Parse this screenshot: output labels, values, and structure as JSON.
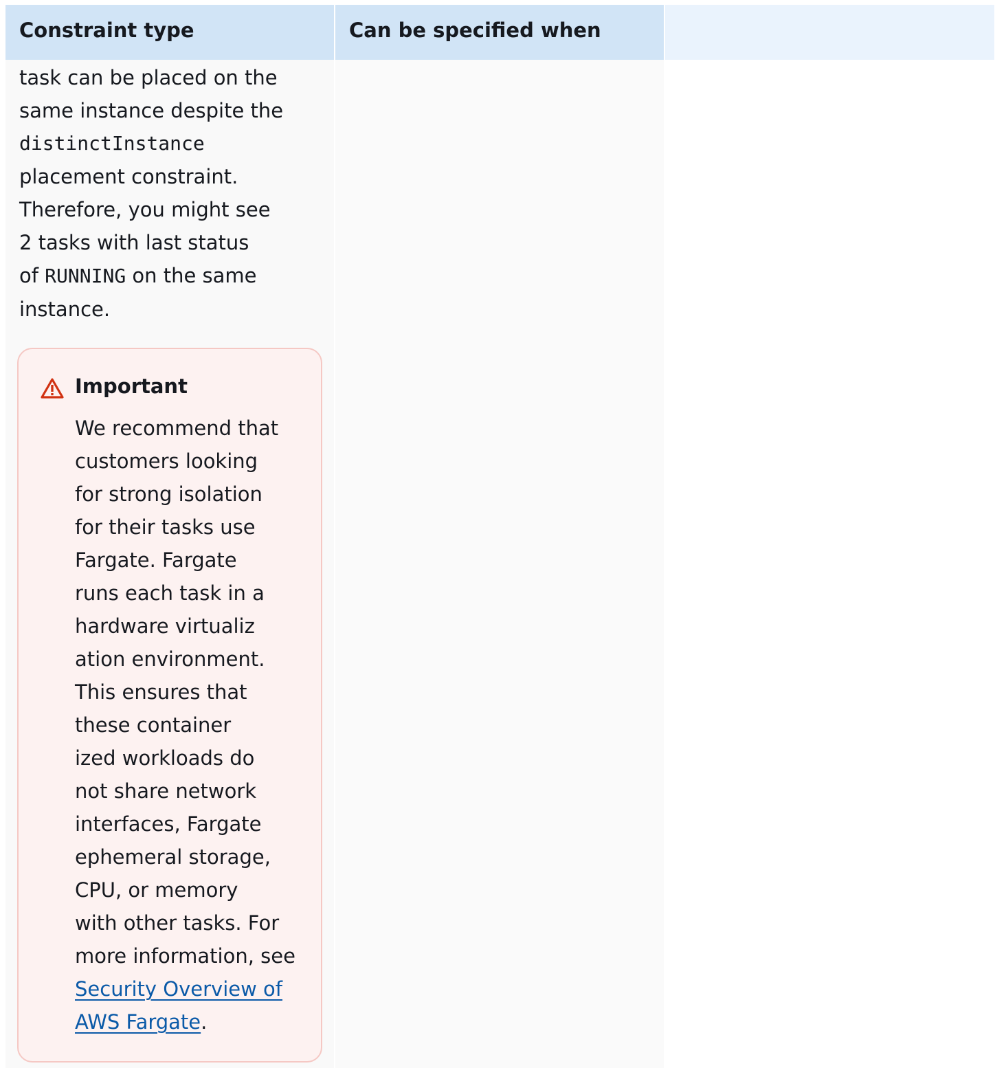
{
  "table": {
    "headers": [
      "Constraint type",
      "Can be specified when",
      ""
    ]
  },
  "row": {
    "text_lines": [
      "task can be placed on the",
      "same instance despite the",
      "distinctInstance",
      "placement constraint.",
      "Therefore, you might see",
      "2 tasks with last status",
      "of RUNNING on the same",
      "instance."
    ],
    "code_terms": [
      "distinctInstance",
      "RUNNING"
    ]
  },
  "alert": {
    "icon": "warning-icon",
    "title": "Important",
    "body_lines": [
      "We recommend that",
      "customers looking",
      "for strong isolation",
      "for their tasks use",
      "Fargate. Fargate",
      "runs each task in a",
      "hardware virtualiz",
      "ation environment.",
      "This ensures that",
      "these container",
      "ized workloads do",
      "not share network",
      "interfaces, Fargate",
      "ephemeral storage,",
      "CPU, or memory",
      "with other tasks. For",
      "more information, see"
    ],
    "link_lines": [
      "Security Overview of",
      "AWS Fargate"
    ],
    "link_suffix": "."
  },
  "colors": {
    "header_bg": "#d1e4f6",
    "header_bg_empty": "#eaf3fd",
    "alert_bg": "#fdf2f1",
    "alert_border": "#f5c8c4",
    "warning_red": "#d13212",
    "link": "#0b5aa8"
  }
}
